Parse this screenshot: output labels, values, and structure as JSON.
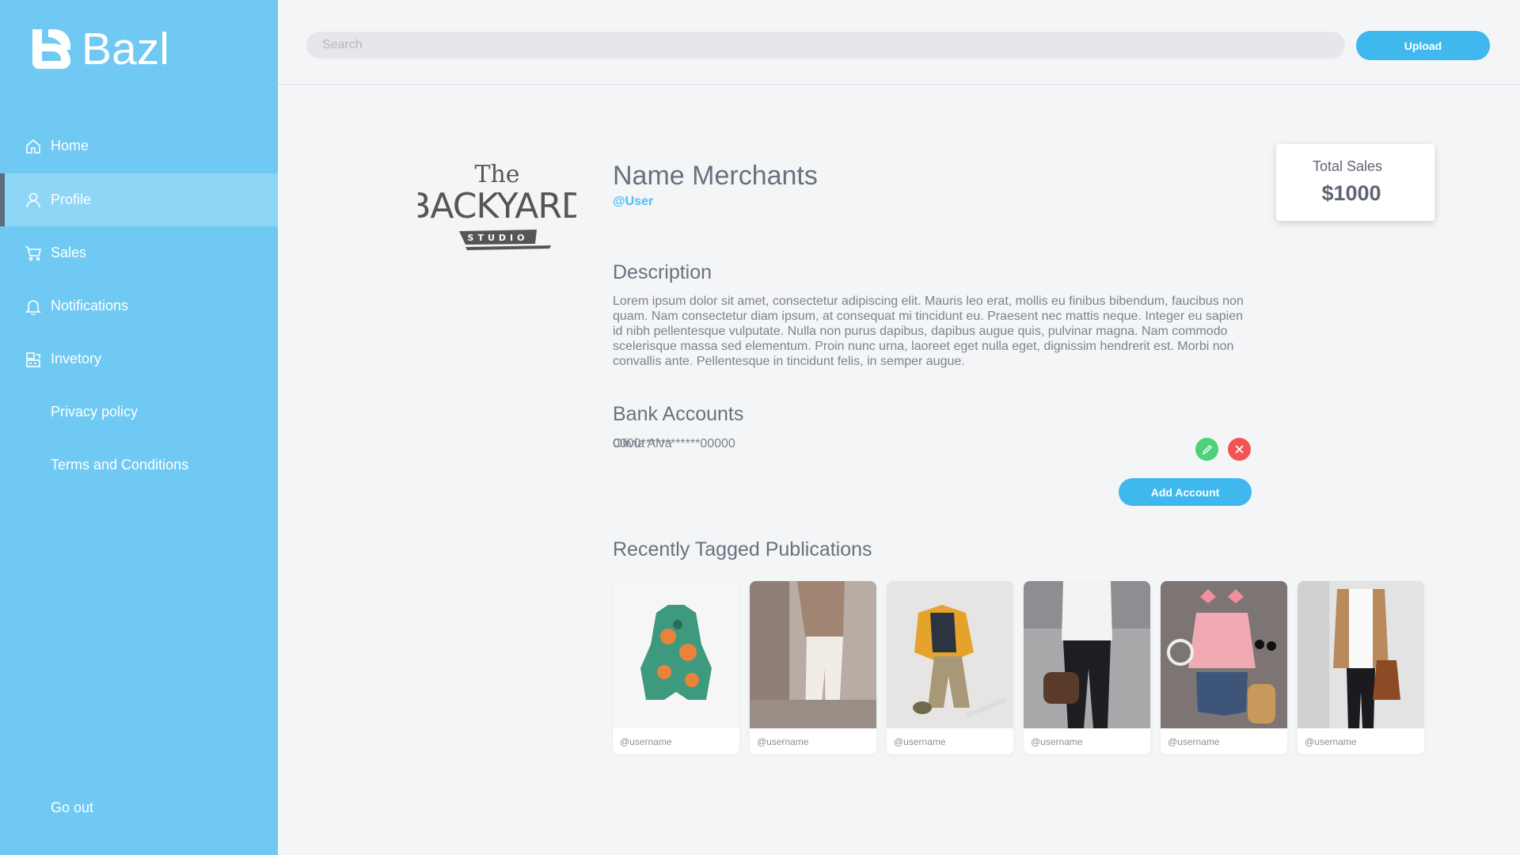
{
  "app": {
    "name": "Bazl"
  },
  "sidebar": {
    "items": [
      {
        "label": "Home",
        "icon": "home-icon"
      },
      {
        "label": "Profile",
        "icon": "user-icon",
        "active": true
      },
      {
        "label": "Sales",
        "icon": "cart-icon"
      },
      {
        "label": "Notifications",
        "icon": "bell-icon"
      },
      {
        "label": "Invetory",
        "icon": "inventory-icon"
      },
      {
        "label": "Privacy policy"
      },
      {
        "label": "Terms and Conditions"
      }
    ],
    "logout_label": "Go out"
  },
  "header": {
    "search_placeholder": "Search",
    "upload_label": "Upload"
  },
  "profile": {
    "brand_logo": {
      "line1": "The",
      "line2": "BACKYARD",
      "line3": "STUDIO"
    },
    "name": "Name Merchants",
    "username": "@User",
    "total_sales_label": "Total Sales",
    "total_sales_value": "$1000",
    "description_title": "Description",
    "description_text": "Lorem ipsum dolor sit amet, consectetur adipiscing elit. Mauris leo erat, mollis eu finibus bibendum, faucibus non quam. Nam consectetur diam ipsum, at consequat mi tincidunt eu. Praesent nec mattis neque. Integer eu sapien id nibh pellentesque vulputate. Nulla non purus dapibus, dapibus augue quis, pulvinar magna. Nam commodo scelerisque massa sed elementum. Proin nunc urna, laoreet eget nulla eget, dignissim hendrerit est. Morbi non convallis ante. Pellentesque in tincidunt felis, in semper augue.",
    "bank_title": "Bank Accounts",
    "bank_account": {
      "holder": "Olivia Alva",
      "number": "0000************00000"
    },
    "add_account_label": "Add Account",
    "publications_title": "Recently Tagged Publications",
    "publications": [
      {
        "user": "@username"
      },
      {
        "user": "@username"
      },
      {
        "user": "@username"
      },
      {
        "user": "@username"
      },
      {
        "user": "@username"
      },
      {
        "user": "@username"
      }
    ]
  },
  "colors": {
    "sidebar": "#6fc9f3",
    "accent": "#3fb8ee",
    "edit": "#4fd07a",
    "delete": "#f25454"
  }
}
